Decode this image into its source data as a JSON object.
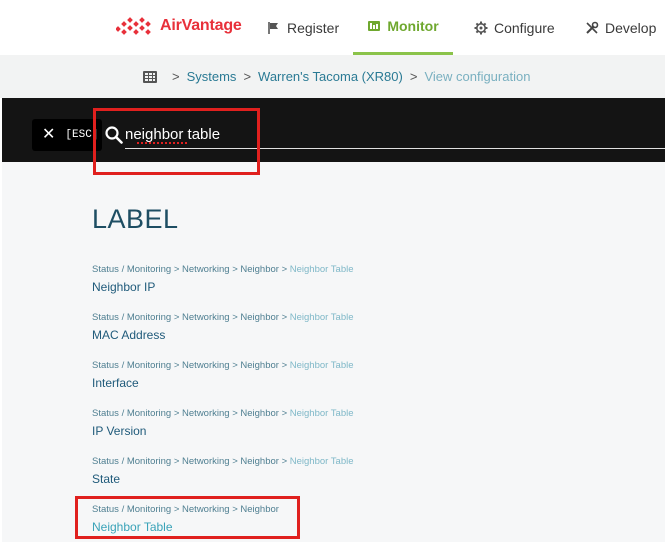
{
  "brand": {
    "name": "AirVantage",
    "color": "#e8303a"
  },
  "nav": {
    "items": [
      {
        "label": "Register",
        "icon": "flag-icon"
      },
      {
        "label": "Monitor",
        "icon": "dashboard-icon",
        "active": true
      },
      {
        "label": "Configure",
        "icon": "gear-icon"
      },
      {
        "label": "Develop",
        "icon": "tools-icon"
      }
    ],
    "active_color": "#6fa82f"
  },
  "breadcrumb": {
    "icon": "systems-grid-icon",
    "items": [
      "Systems",
      "Warren's Tacoma (XR80)"
    ],
    "current": "View configuration"
  },
  "search": {
    "esc_label": "[ESC]",
    "value": "neighbor table",
    "icon": "search-icon",
    "close_icon": "close-icon"
  },
  "results": {
    "heading": "LABEL",
    "items": [
      {
        "path": "Status / Monitoring > Networking > Neighbor > ",
        "path_last": "Neighbor Table",
        "title": "Neighbor IP"
      },
      {
        "path": "Status / Monitoring > Networking > Neighbor > ",
        "path_last": "Neighbor Table",
        "title": "MAC Address"
      },
      {
        "path": "Status / Monitoring > Networking > Neighbor > ",
        "path_last": "Neighbor Table",
        "title": "Interface"
      },
      {
        "path": "Status / Monitoring > Networking > Neighbor > ",
        "path_last": "Neighbor Table",
        "title": "IP Version"
      },
      {
        "path": "Status / Monitoring > Networking > Neighbor > ",
        "path_last": "Neighbor Table",
        "title": "State"
      },
      {
        "path": "Status / Monitoring > Networking > Neighbor",
        "path_last": "",
        "title": "Neighbor Table"
      }
    ]
  }
}
